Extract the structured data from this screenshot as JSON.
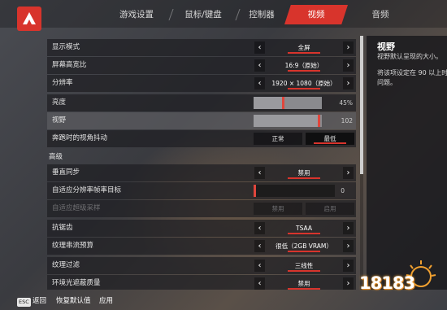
{
  "colors": {
    "accent": "#d8342c",
    "panel": "#1e1e22",
    "highlight": "#5f5f64"
  },
  "logo": {
    "icon": "apex-logo-icon"
  },
  "tabs": [
    {
      "label": "游戏设置",
      "active": false
    },
    {
      "label": "鼠标/键盘",
      "active": false
    },
    {
      "label": "控制器",
      "active": false
    },
    {
      "label": "视频",
      "active": true
    },
    {
      "label": "音频",
      "active": false
    }
  ],
  "settings": {
    "display_mode": {
      "label": "显示模式",
      "value": "全屏"
    },
    "aspect_ratio": {
      "label": "屏幕高宽比",
      "value": "16:9（原始）"
    },
    "resolution": {
      "label": "分辨率",
      "value": "1920 × 1080（原始）"
    },
    "brightness": {
      "label": "亮度",
      "value": "45%",
      "level": 0.45
    },
    "fov": {
      "label": "视野",
      "value": "102",
      "level": 0.98
    },
    "sprint_shake": {
      "label": "奔跑时的视角抖动",
      "options": [
        "正常",
        "最低"
      ],
      "selected": "最低"
    },
    "advanced_label": "高级",
    "vsync": {
      "label": "垂直同步",
      "value": "禁用"
    },
    "adaptive_target": {
      "label": "自适应分辨率帧率目标",
      "value": "0",
      "level": 0.0
    },
    "adaptive_supersampling": {
      "label": "自适应超级采样",
      "options": [
        "禁用",
        "启用"
      ]
    },
    "anti_aliasing": {
      "label": "抗锯齿",
      "value": "TSAA"
    },
    "texture_budget": {
      "label": "纹理串流预算",
      "value": "很低（2GB VRAM）"
    },
    "texture_filter": {
      "label": "纹理过滤",
      "value": "三线性"
    },
    "ambient_occlusion": {
      "label": "环境光遮蔽质量",
      "value": "禁用"
    }
  },
  "arrows": {
    "left": "‹",
    "right": "›"
  },
  "description": {
    "title": "视野",
    "line1": "视野默认呈现的大小。",
    "line2": "将该项设定在 90 以上时",
    "line3": "问题。"
  },
  "footer": {
    "esc_key": "ESC",
    "back": "返回",
    "reset": "恢复默认值",
    "apply": "应用"
  },
  "watermark": {
    "text": "18183"
  }
}
